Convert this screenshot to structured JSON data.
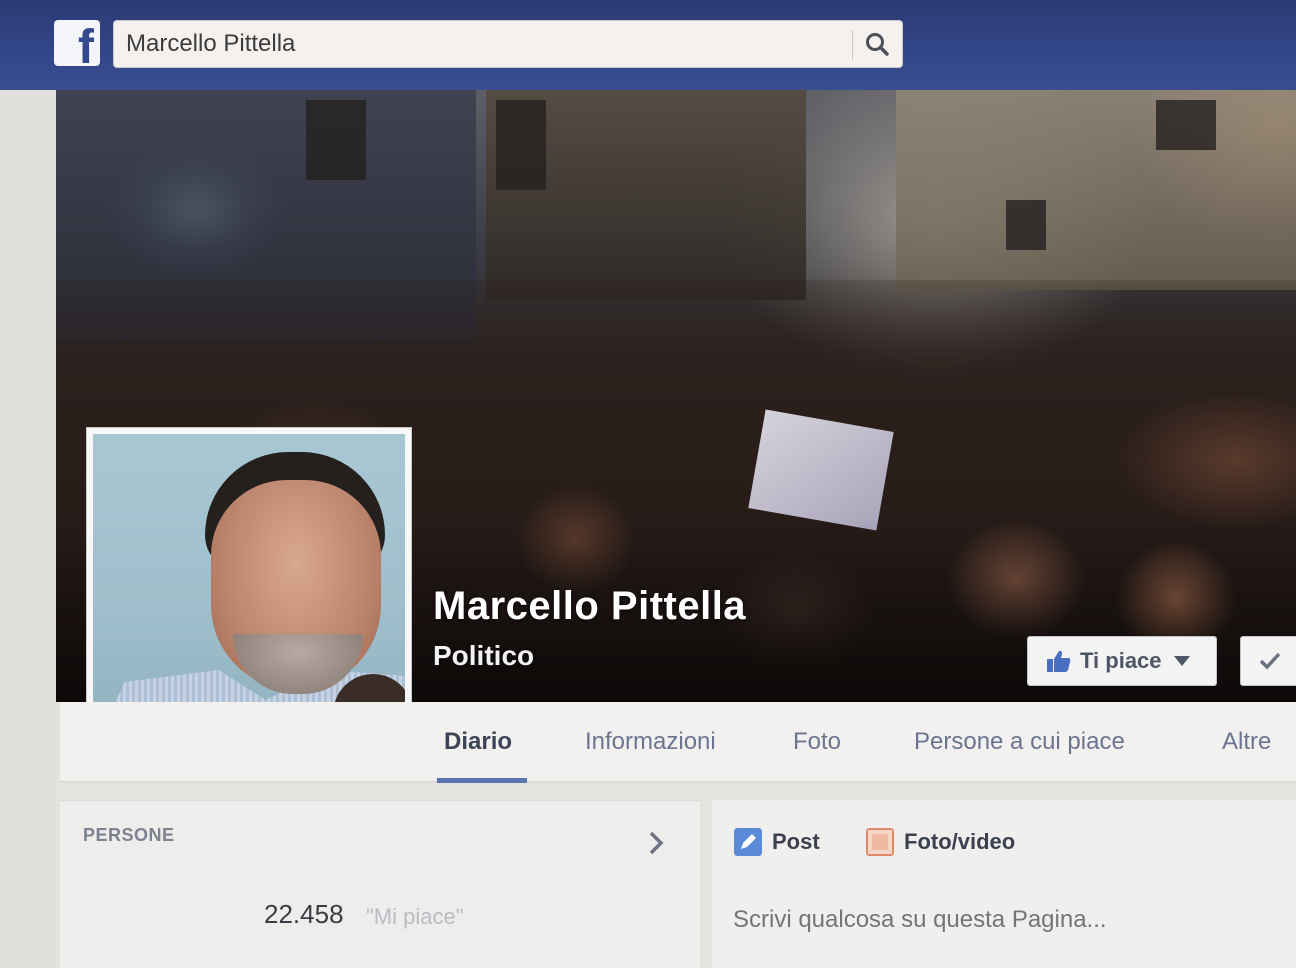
{
  "search": {
    "value": "Marcello Pittella"
  },
  "page": {
    "name": "Marcello Pittella",
    "category": "Politico",
    "like_button": "Ti piace"
  },
  "tabs": [
    {
      "label": "Diario",
      "active": true
    },
    {
      "label": "Informazioni",
      "active": false
    },
    {
      "label": "Foto",
      "active": false
    },
    {
      "label": "Persone a cui piace",
      "active": false
    },
    {
      "label": "Altre",
      "active": false
    }
  ],
  "people_section": {
    "title": "PERSONE",
    "likes_count": "22.458",
    "likes_label": "\"Mi piace\""
  },
  "composer": {
    "post_label": "Post",
    "photo_video_label": "Foto/video",
    "placeholder": "Scrivi qualcosa su questa Pagina..."
  },
  "colors": {
    "topbar": "#33468a",
    "accent": "#5a74b0",
    "like_icon": "#4a6fc1"
  },
  "icons": [
    "facebook-logo",
    "search-icon",
    "thumbs-up-icon",
    "caret-down-icon",
    "check-icon",
    "chevron-right-icon",
    "pencil-icon",
    "photo-icon"
  ]
}
